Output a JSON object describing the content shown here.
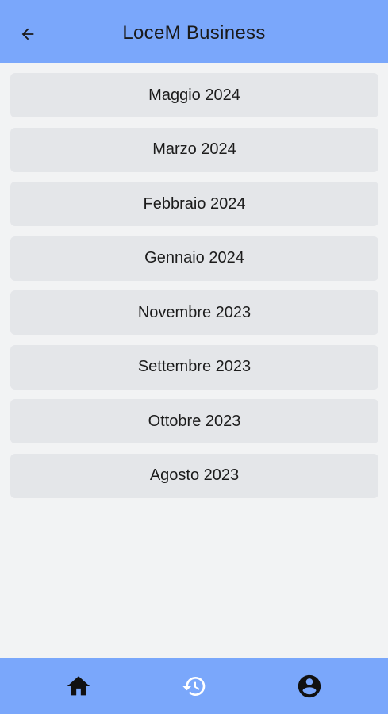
{
  "header": {
    "title": "LoceM Business",
    "back_icon": "arrow-left-icon"
  },
  "months": [
    {
      "label": "Maggio 2024"
    },
    {
      "label": "Marzo 2024"
    },
    {
      "label": "Febbraio 2024"
    },
    {
      "label": "Gennaio 2024"
    },
    {
      "label": "Novembre 2023"
    },
    {
      "label": "Settembre 2023"
    },
    {
      "label": "Ottobre 2023"
    },
    {
      "label": "Agosto 2023"
    }
  ],
  "bottom_nav": {
    "items": [
      {
        "icon": "home-icon"
      },
      {
        "icon": "history-icon"
      },
      {
        "icon": "account-icon"
      }
    ]
  },
  "colors": {
    "app_bar": "#7aa7fb",
    "background": "#f2f3f4",
    "list_item": "#e4e6e9"
  }
}
